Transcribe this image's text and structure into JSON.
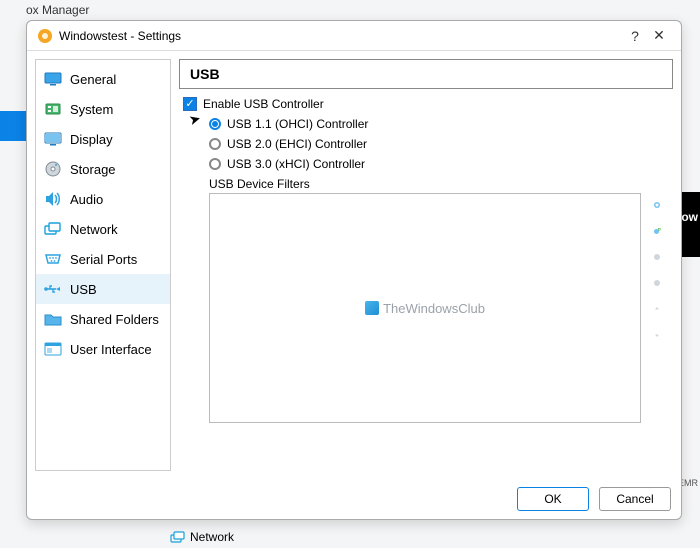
{
  "parent_window": {
    "title_fragment": "ox Manager"
  },
  "dialog": {
    "title": "Windowstest - Settings",
    "help": "?",
    "close": "✕"
  },
  "sidebar": {
    "items": [
      {
        "label": "General"
      },
      {
        "label": "System"
      },
      {
        "label": "Display"
      },
      {
        "label": "Storage"
      },
      {
        "label": "Audio"
      },
      {
        "label": "Network"
      },
      {
        "label": "Serial Ports"
      },
      {
        "label": "USB"
      },
      {
        "label": "Shared Folders"
      },
      {
        "label": "User Interface"
      }
    ],
    "selected_index": 7
  },
  "panel": {
    "title": "USB",
    "enable_label": "Enable USB Controller",
    "enable_checked": true,
    "controllers": [
      {
        "label": "USB 1.1 (OHCI) Controller",
        "selected": true
      },
      {
        "label": "USB 2.0 (EHCI) Controller",
        "selected": false
      },
      {
        "label": "USB 3.0 (xHCI) Controller",
        "selected": false
      }
    ],
    "filters_label": "USB Device Filters",
    "watermark": "TheWindowsClub"
  },
  "footer": {
    "ok": "OK",
    "cancel": "Cancel"
  },
  "background": {
    "ow": "ow",
    "oemr": "_OEMR",
    "network_label": "Network"
  }
}
